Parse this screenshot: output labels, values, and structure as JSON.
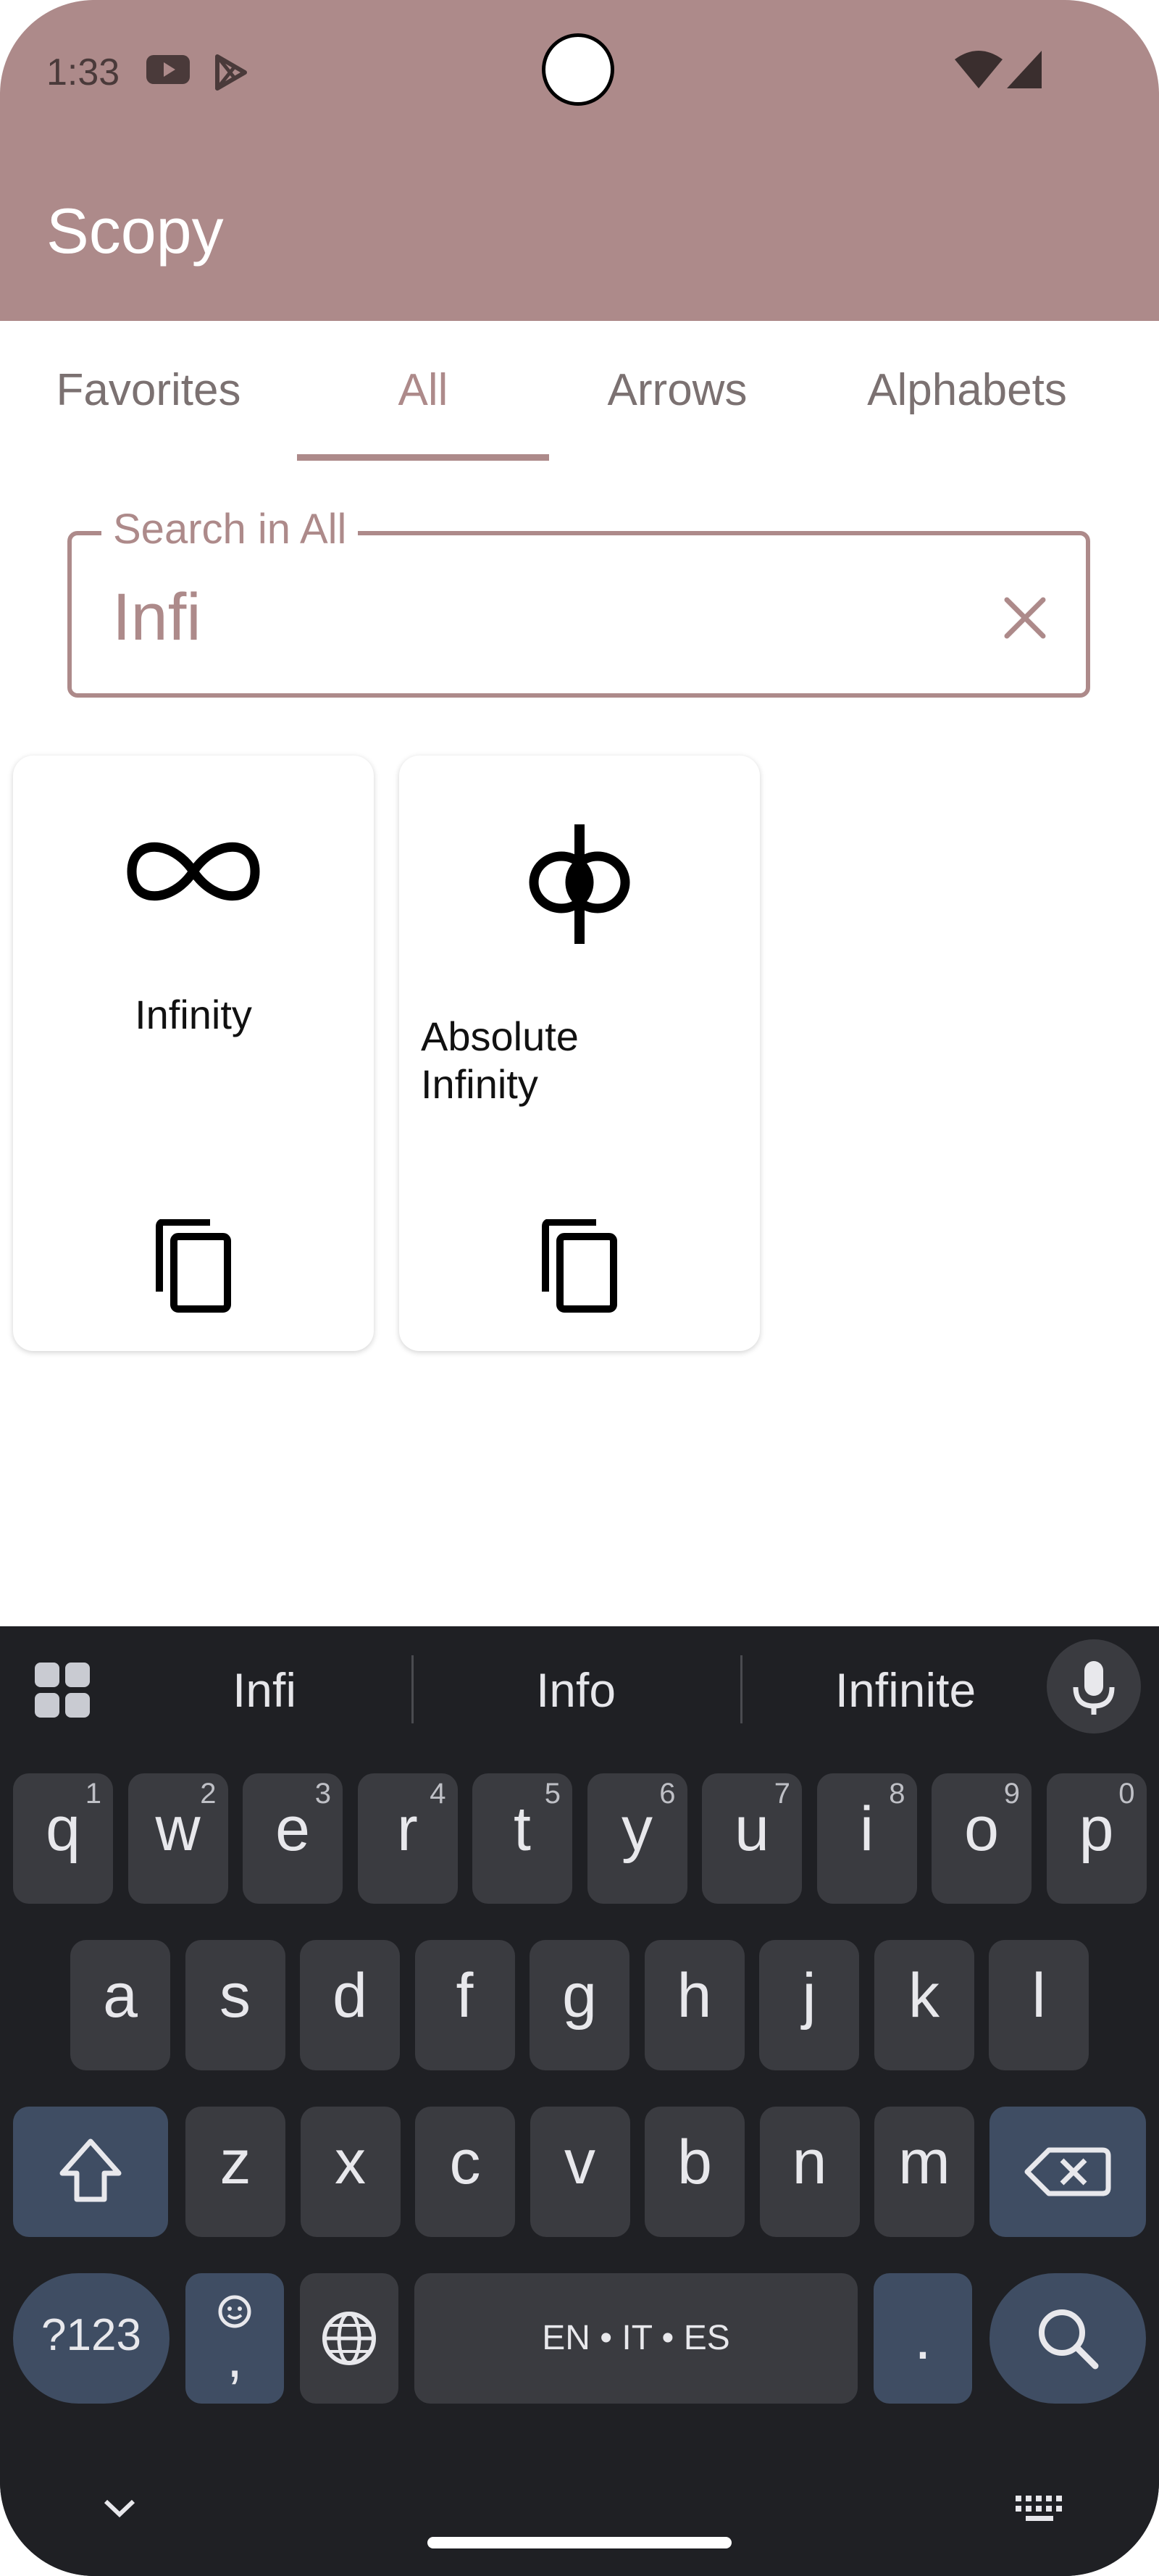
{
  "status": {
    "time": "1:33"
  },
  "app": {
    "title": "Scopy",
    "brand_color": "#ad8a8a"
  },
  "tabs": [
    {
      "label": "Favorites"
    },
    {
      "label": "All",
      "active": true
    },
    {
      "label": "Arrows"
    },
    {
      "label": "Alphabets"
    }
  ],
  "search": {
    "label": "Search in All",
    "value": "Infi"
  },
  "results": [
    {
      "symbol": "∞",
      "name": "Infinity"
    },
    {
      "symbol": "ɸ",
      "name": "Absolute Infinity"
    }
  ],
  "keyboard": {
    "suggestions": [
      "Infi",
      "Info",
      "Infinite"
    ],
    "row1": [
      {
        "k": "q",
        "h": "1"
      },
      {
        "k": "w",
        "h": "2"
      },
      {
        "k": "e",
        "h": "3"
      },
      {
        "k": "r",
        "h": "4"
      },
      {
        "k": "t",
        "h": "5"
      },
      {
        "k": "y",
        "h": "6"
      },
      {
        "k": "u",
        "h": "7"
      },
      {
        "k": "i",
        "h": "8"
      },
      {
        "k": "o",
        "h": "9"
      },
      {
        "k": "p",
        "h": "0"
      }
    ],
    "row2": [
      "a",
      "s",
      "d",
      "f",
      "g",
      "h",
      "j",
      "k",
      "l"
    ],
    "row3": [
      "z",
      "x",
      "c",
      "v",
      "b",
      "n",
      "m"
    ],
    "symbols_key": "?123",
    "emoji_key": ",",
    "space_label": "EN • IT • ES",
    "period_key": "."
  }
}
